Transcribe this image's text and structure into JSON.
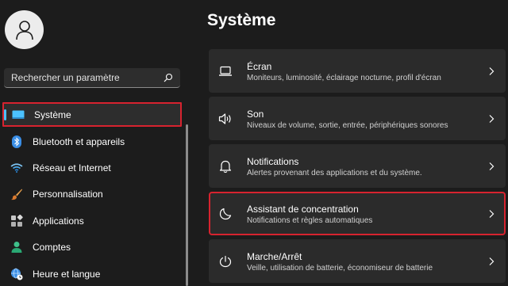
{
  "sidebar": {
    "search": {
      "placeholder": "Rechercher un paramètre",
      "icon": "search-icon"
    },
    "nav": [
      {
        "label": "Système",
        "icon": "display-icon",
        "active": true
      },
      {
        "label": "Bluetooth et appareils",
        "icon": "bluetooth-icon"
      },
      {
        "label": "Réseau et Internet",
        "icon": "wifi-icon"
      },
      {
        "label": "Personnalisation",
        "icon": "brush-icon"
      },
      {
        "label": "Applications",
        "icon": "apps-icon"
      },
      {
        "label": "Comptes",
        "icon": "accounts-icon"
      },
      {
        "label": "Heure et langue",
        "icon": "globe-clock-icon"
      }
    ]
  },
  "main": {
    "title": "Système",
    "cards": [
      {
        "title": "Écran",
        "subtitle": "Moniteurs, luminosité, éclairage nocturne, profil d'écran",
        "icon": "laptop-icon"
      },
      {
        "title": "Son",
        "subtitle": "Niveaux de volume, sortie, entrée, périphériques sonores",
        "icon": "speaker-icon"
      },
      {
        "title": "Notifications",
        "subtitle": "Alertes provenant des applications et du système.",
        "icon": "bell-icon"
      },
      {
        "title": "Assistant de concentration",
        "subtitle": "Notifications et règles automatiques",
        "icon": "moon-icon",
        "highlighted": true
      },
      {
        "title": "Marche/Arrêt",
        "subtitle": "Veille, utilisation de batterie, économiseur de batterie",
        "icon": "power-icon"
      }
    ]
  },
  "colors": {
    "background": "#1c1c1c",
    "card": "#2b2b2b",
    "accent": "#4cc2ff",
    "highlight_border": "#d7232f"
  }
}
